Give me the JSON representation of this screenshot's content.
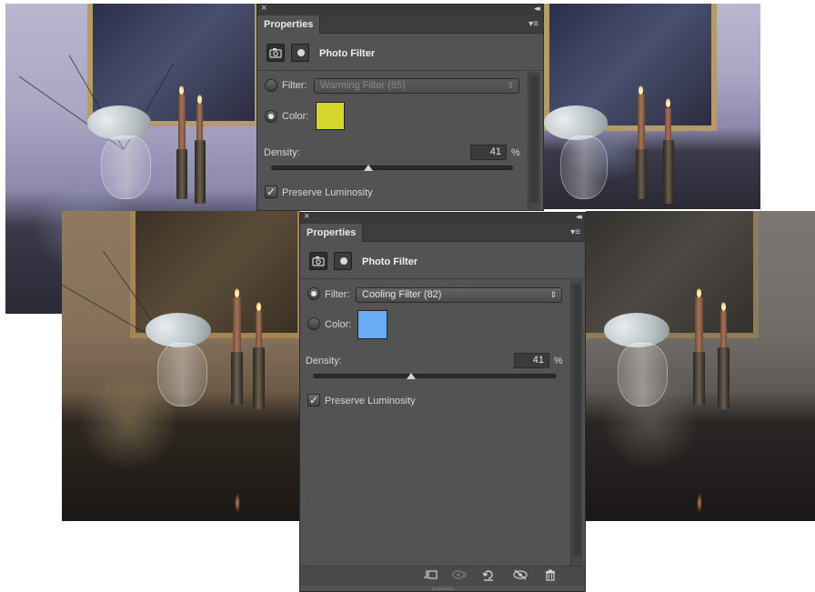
{
  "panels": {
    "warming": {
      "tab": "Properties",
      "title": "Photo Filter",
      "filter_label": "Filter:",
      "filter_value": "Warming Filter (85)",
      "color_label": "Color:",
      "color_hex": "#d4d62e",
      "density_label": "Density:",
      "density_value": "41",
      "density_unit": "%",
      "density_level": 0.41,
      "preserve_label": "Preserve Luminosity",
      "preserve_checked": true,
      "selected_mode": "color"
    },
    "cooling": {
      "tab": "Properties",
      "title": "Photo Filter",
      "filter_label": "Filter:",
      "filter_value": "Cooling Filter (82)",
      "color_label": "Color:",
      "color_hex": "#6aabf5",
      "density_label": "Density:",
      "density_value": "41",
      "density_unit": "%",
      "density_level": 0.41,
      "preserve_label": "Preserve Luminosity",
      "preserve_checked": true,
      "selected_mode": "filter"
    }
  },
  "icons": {
    "close": "×",
    "collapse": "◂◂",
    "panel_menu": "▾≡",
    "adjustment_layer": "camera-adjustment-icon",
    "layer_mask": "mask-icon",
    "select_arrows": "⌃⌄",
    "checkmark": "✓",
    "bottom_toolbar": [
      "clip-to-layer-icon",
      "view-previous-state-icon",
      "reset-icon",
      "toggle-visibility-icon",
      "trash-icon"
    ]
  }
}
